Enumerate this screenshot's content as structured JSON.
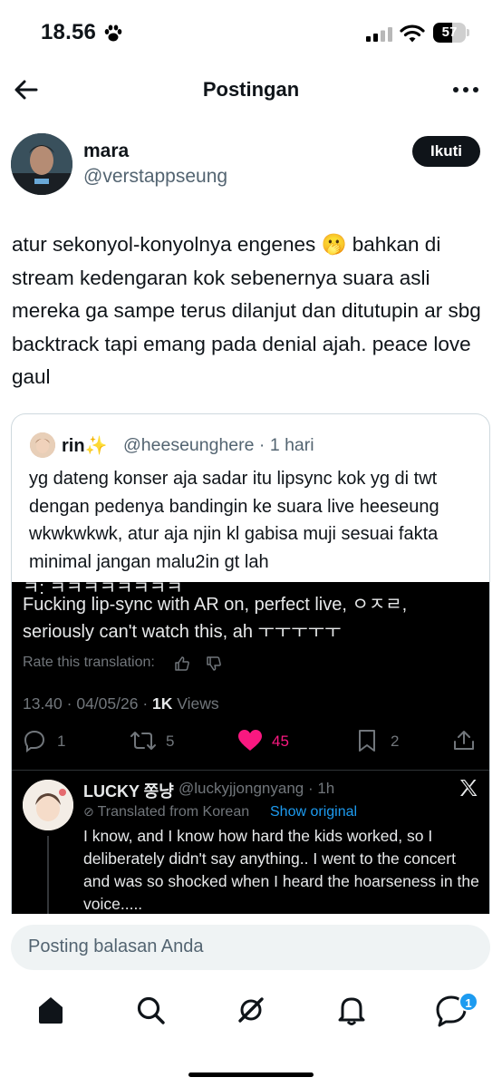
{
  "status_bar": {
    "time": "18.56",
    "battery": "57",
    "battery_level": 0.57
  },
  "header": {
    "title": "Postingan"
  },
  "post": {
    "author_name": "mara",
    "author_handle": "@verstappseung",
    "follow_label": "Ikuti",
    "text": "atur sekonyol-konyolnya engenes 🫢 bahkan di stream kedengaran kok sebenernya suara asli mereka ga sampe terus dilanjut dan ditutupin ar sbg backtrack tapi emang pada denial ajah. peace love gaul"
  },
  "quote": {
    "author_name": "rin✨",
    "author_meta": "@heeseunghere · 1 hari",
    "text": "yg dateng konser aja sadar itu lipsync kok yg di twt dengan pedenya bandingin ke suara live heeseung wkwkwkwk, atur aja njin kl gabisa muji sesuai fakta minimal jangan malu2in gt lah"
  },
  "embed": {
    "cut_text": "ㅋ: ㅋㅋㅋㅋㅋㅋㅋㅋ",
    "text": "Fucking lip-sync with AR on, perfect live, ㅇㅈㄹ, seriously can't watch this, ah ㅜㅜㅜㅜㅜ",
    "rate_label": "Rate this translation:",
    "timestamp": "13.40 · 04/05/26 · ",
    "views_count": "1K",
    "views_label": " Views",
    "actions": {
      "replies": "1",
      "reposts": "5",
      "likes": "45",
      "bookmarks": "2"
    },
    "like_color": "#f91880",
    "reply": {
      "name": "LUCKY 쫑냥",
      "handle": "@luckyjjongnyang · 1h",
      "translated_label": "Translated from Korean",
      "show_original": "Show original",
      "text": "I know, and I know how hard the kids worked, so I deliberately didn't say anything.. I went to the concert and was so shocked when I heard the hoarseness in the voice....."
    }
  },
  "composer": {
    "placeholder": "Posting balasan Anda"
  },
  "nav": {
    "items": [
      "home-icon",
      "search-icon",
      "grok-icon",
      "bell-icon",
      "messages-icon"
    ],
    "messages_badge": "1",
    "accent_color": "#1d9bf0"
  }
}
